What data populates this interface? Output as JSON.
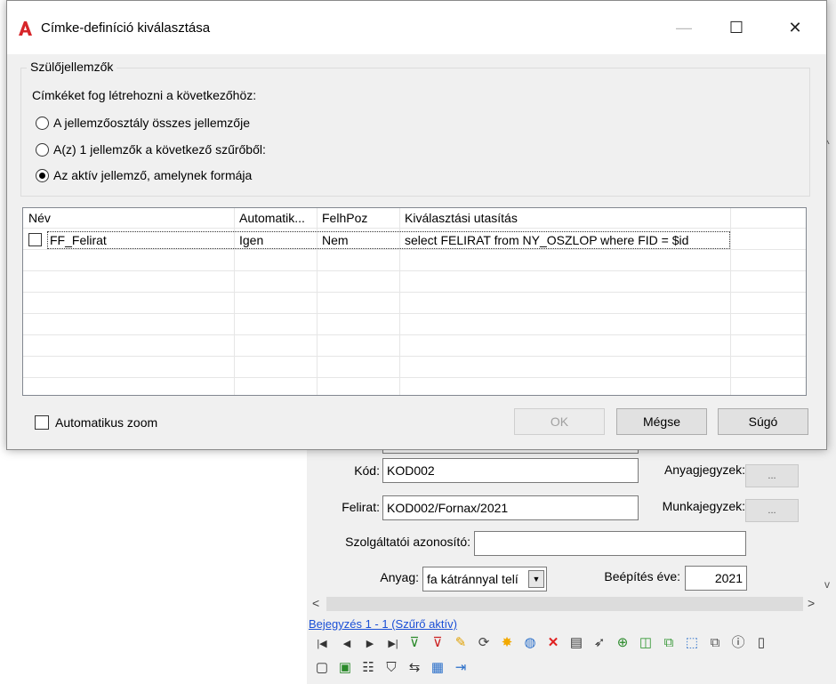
{
  "dialog": {
    "title": "Címke-definíció kiválasztása",
    "window_buttons": {
      "minimize": "—",
      "maximize": "☐",
      "close": "✕"
    },
    "group": {
      "legend": "Szülőjellemzők",
      "description": "Címkéket fog létrehozni a következőhöz:",
      "options": [
        {
          "label": "A jellemzőosztály összes jellemzője",
          "checked": false
        },
        {
          "label": "A(z) 1 jellemzők a következő szűrőből:",
          "checked": false
        },
        {
          "label": "Az aktív jellemző, amelynek formája",
          "checked": true
        }
      ]
    },
    "table": {
      "columns": [
        "Név",
        "Automatik...",
        "FelhPoz",
        "Kiválasztási utasítás"
      ],
      "rows": [
        {
          "checked": false,
          "cells": [
            "FF_Felirat",
            "Igen",
            "Nem",
            "select FELIRAT from NY_OSZLOP where FID = $id"
          ]
        }
      ]
    },
    "auto_zoom_label": "Automatikus zoom",
    "auto_zoom_checked": false,
    "buttons": {
      "ok": "OK",
      "cancel": "Mégse",
      "help": "Súgó"
    }
  },
  "background_form": {
    "kod_label": "Kód:",
    "kod_value": "KOD002",
    "anyagjegyzek_label": "Anyagjegyzek:",
    "anyagjegyzek_button": "...",
    "felirat_label": "Felirat:",
    "felirat_value": "KOD002/Fornax/2021",
    "munkajegyzek_label": "Munkajegyzek:",
    "munkajegyzek_button": "...",
    "szolg_label": "Szolgáltatói azonosító:",
    "szolg_value": "",
    "anyag_label": "Anyag:",
    "anyag_value": "fa kátránnyal telí",
    "beepites_label": "Beépítés éve:",
    "beepites_value": "2021",
    "status": "Bejegyzés 1 - 1 (Szűrő aktív)",
    "colors": {
      "status_text": "#1a4fd6",
      "ok_disabled_text": "#a0a0a0"
    }
  }
}
